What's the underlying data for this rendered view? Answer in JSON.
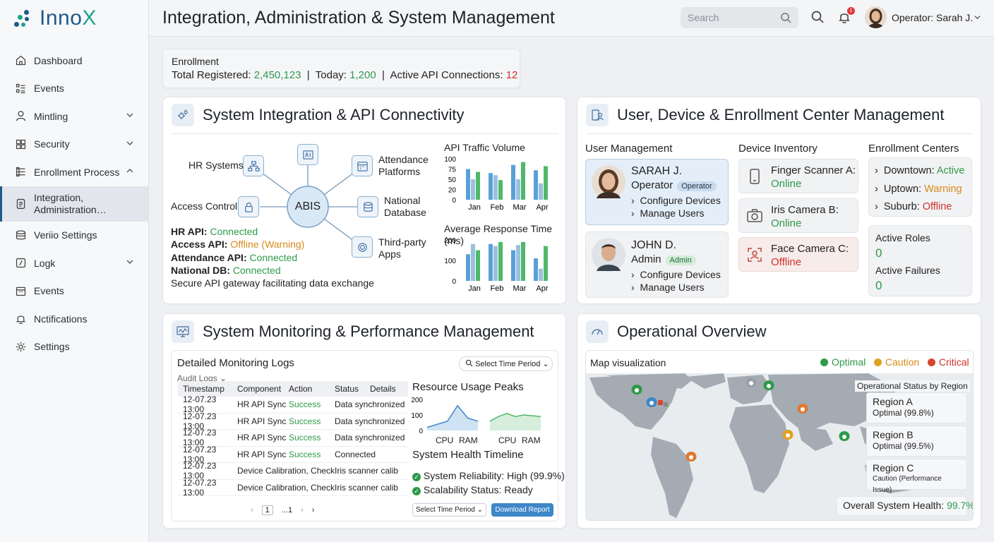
{
  "app": {
    "brand_prefix": "Inno",
    "brand_suffix": "X"
  },
  "sidebar": {
    "items": [
      {
        "label": "Dashboard",
        "icon": "home-icon"
      },
      {
        "label": "Events",
        "icon": "list-icon"
      },
      {
        "label": "Mintling",
        "icon": "user-icon"
      },
      {
        "label": "Security",
        "icon": "grid-icon"
      },
      {
        "label": "Enrollment Process",
        "icon": "layers-icon"
      },
      {
        "label": "Integration, Administration…",
        "icon": "clipboard-icon"
      },
      {
        "label": "Veriio Settings",
        "icon": "database-icon"
      },
      {
        "label": "Logk",
        "icon": "log-icon"
      },
      {
        "label": "Events",
        "icon": "calendar-icon"
      },
      {
        "label": "Nctifications",
        "icon": "bell-icon"
      },
      {
        "label": "Settings",
        "icon": "gear-icon"
      }
    ]
  },
  "header": {
    "title": "Integration, Administration & System Management",
    "search_placeholder": "Search",
    "notification_count": "1",
    "user": "Operator: Sarah J."
  },
  "enrollment": {
    "title": "Enrollment",
    "total_label": "Total Registered:",
    "total_value": "2,450,123",
    "today_label": "Today:",
    "today_value": "1,200",
    "api_label": "Active API Connections:",
    "api_value": "12"
  },
  "integration": {
    "title": "System Integration & API Connectivity",
    "hub": "ABIS",
    "nodes": {
      "hr": "HR Systems",
      "access": "Access Control",
      "attendance_1": "Attendance",
      "attendance_2": "Platforms",
      "national_1": "National",
      "national_2": "Database",
      "third_1": "Third-party",
      "third_2": "Apps"
    },
    "status": [
      {
        "label": "HR API:",
        "value": "Connected"
      },
      {
        "label": "Access API:",
        "value": "Offline (Warning)"
      },
      {
        "label": "Attendance API:",
        "value": "Connected"
      },
      {
        "label": "National DB:",
        "value": "Connected"
      }
    ],
    "note": "Secure API gateway facilitating data exchange",
    "traffic_title": "API Traffic Volume",
    "response_title": "Average Response Time (ms)",
    "months": [
      "Jan",
      "Feb",
      "Mar",
      "Apr"
    ],
    "traffic_ticks": [
      "100",
      "75",
      "50",
      "20",
      "0"
    ],
    "response_ticks": [
      "200",
      "100",
      "0"
    ]
  },
  "chart_data": [
    {
      "type": "bar",
      "title": "API Traffic Volume",
      "categories": [
        "Jan",
        "Feb",
        "Mar",
        "Apr"
      ],
      "ylim": [
        0,
        100
      ],
      "series": [
        {
          "values": [
            75,
            65,
            85,
            72
          ]
        },
        {
          "values": [
            50,
            60,
            50,
            40
          ]
        },
        {
          "values": [
            68,
            48,
            92,
            82
          ]
        }
      ]
    },
    {
      "type": "bar",
      "title": "Average Response Time (ms)",
      "categories": [
        "Jan",
        "Feb",
        "Mar",
        "Apr"
      ],
      "ylim": [
        0,
        200
      ],
      "series": [
        {
          "values": [
            130,
            180,
            150,
            110
          ]
        },
        {
          "values": [
            180,
            170,
            175,
            60
          ]
        },
        {
          "values": [
            150,
            190,
            190,
            170
          ]
        }
      ]
    },
    {
      "type": "area",
      "title": "Resource Usage Peaks",
      "categories": [
        "CPU",
        "RAM"
      ],
      "ylim": [
        0,
        200
      ],
      "series": [
        {
          "values": [
            20,
            40,
            60,
            160,
            80,
            60
          ]
        },
        {
          "values": [
            60,
            90,
            110,
            90,
            100,
            95,
            90
          ]
        }
      ]
    }
  ],
  "user_mgmt": {
    "title": "User, Device & Enrollment Center Management",
    "users_title": "User Management",
    "users": [
      {
        "name": "SARAH J.",
        "role": "Operator",
        "badge": "Operator",
        "actions": [
          "Configure Devices",
          "Manage Users"
        ]
      },
      {
        "name": "JOHN D.",
        "role": "Admin",
        "badge": "Admin",
        "actions": [
          "Configure Devices",
          "Manage Users"
        ]
      }
    ],
    "devices_title": "Device Inventory",
    "devices": [
      {
        "name": "Finger Scanner A:",
        "status": "Online"
      },
      {
        "name": "Iris Camera B:",
        "status": "Online"
      },
      {
        "name": "Face Camera C:",
        "status": "Offline"
      }
    ],
    "centers_title": "Enrollment Centers",
    "centers": [
      {
        "name": "Downtown:",
        "status": "Active"
      },
      {
        "name": "Uptown:",
        "status": "Warning"
      },
      {
        "name": "Suburb:",
        "status": "Offline"
      }
    ],
    "active_roles_label": "Active Roles",
    "active_roles_value": "0",
    "active_failures_label": "Active Failures",
    "active_failures_value": "0"
  },
  "monitoring": {
    "title": "System Monitoring & Performance Management",
    "logs_title": "Detailed Monitoring Logs",
    "audit": "Audit Logs",
    "period": "Select Time Period",
    "columns": [
      "Timestamp",
      "Component",
      "Action",
      "Status",
      "Details"
    ],
    "rows": [
      [
        "12-07.23 13:00",
        "HR API Sync",
        "Success",
        "Data synchronized"
      ],
      [
        "12-07.23 13:00",
        "HR API Sync",
        "Success",
        "Data synchronized"
      ],
      [
        "12-07.23 13:00",
        "HR API Sync",
        "Success",
        "Data synchronized"
      ],
      [
        "12-07.23 13:00",
        "HR API Sync",
        "Success",
        "Connected"
      ],
      [
        "12-07.23 13:00",
        "Device Calibration, Check",
        "",
        "Iris scanner calib"
      ],
      [
        "12-07.23 13:00",
        "Device Calibration, Check",
        "",
        "Iris scanner calib"
      ]
    ],
    "page": "1",
    "page_more": "...1",
    "resource_title": "Resource Usage Peaks",
    "resource_ticks": [
      "200",
      "100",
      "0"
    ],
    "cpu": "CPU",
    "ram": "RAM",
    "timeline_title": "System Health Timeline",
    "reliability": "System Reliability: High (99.9%)",
    "scalability": "Scalability Status: Ready",
    "period2": "Select Time Period",
    "download": "Download Report"
  },
  "overview": {
    "title": "Operational Overview",
    "map_title": "Map visualization",
    "legend": [
      {
        "label": "Optimal",
        "color": "#2e9a4a"
      },
      {
        "label": "Caution",
        "color": "#e0a020"
      },
      {
        "label": "Critical",
        "color": "#d8452f"
      }
    ],
    "status_title": "Operational Status by Region",
    "regions": [
      {
        "name": "Region A",
        "status": "Optimal (99.8%)"
      },
      {
        "name": "Region B",
        "status": "Optimal (99.5%)"
      },
      {
        "name": "Region C",
        "status": "Caution (Performance Issue)"
      }
    ],
    "health_label": "Overall System Health:",
    "health_value": "99.7%"
  },
  "colors": {
    "primary": "#1f5a8a",
    "success": "#2e9a4a",
    "warning": "#d88a18",
    "danger": "#d0302a",
    "accent": "#1fa38e"
  }
}
